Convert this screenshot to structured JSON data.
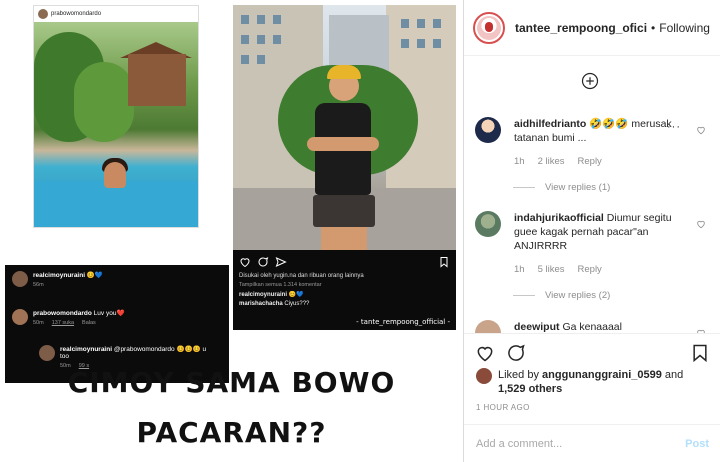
{
  "collage": {
    "pool_post": {
      "username": "prabowomondardo"
    },
    "street_post": {
      "liked_by": "Disukai oleh yugin.na dan ribuan orang lainnya",
      "view_comments": "Tampilkan semua 1.314 komentar",
      "caption_user": "realcimoynuraini",
      "caption_text": "😊💙",
      "reply_user": "marishachacha",
      "reply_text": "Ciyus???",
      "watermark": "- tante_rempoong_official -"
    },
    "chat": [
      {
        "user": "realcimoynuraini",
        "text": "😊💙",
        "time": "56m",
        "likes": "",
        "reply": ""
      },
      {
        "user": "prabowomondardo",
        "text": "Luv you❤️",
        "time": "50m",
        "likes": "137 suka",
        "reply": "Balas"
      },
      {
        "user": "realcimoynuraini",
        "text": "@prabowomondardo 😊😊😊 u too",
        "time": "50m",
        "likes": "99 s",
        "reply": ""
      }
    ],
    "headline_line1": "CIMOY SAMA BOWO",
    "headline_line2": "PACARAN??"
  },
  "panel": {
    "header": {
      "username": "tantee_rempoong_ofici",
      "separator": "•",
      "follow_status": "Following"
    },
    "add_icon": "plus-circle-icon",
    "comments": [
      {
        "user": "aidhilfedrianto",
        "text": "🤣🤣🤣 merusak tatanan bumi ...",
        "time": "1h",
        "likes": "2 likes",
        "reply": "Reply",
        "view_replies": "View replies (1)"
      },
      {
        "user": "indahjurikaofficial",
        "text": "Diumur segitu guee kagak pernah pacar\"an ANJIRRRR",
        "time": "1h",
        "likes": "5 likes",
        "reply": "Reply",
        "view_replies": "View replies (2)"
      },
      {
        "user": "deewiput",
        "text": "Ga kenaaaal",
        "time": "",
        "likes": "",
        "reply": "",
        "view_replies": ""
      }
    ],
    "likes": {
      "prefix": "Liked by",
      "user": "anggunanggraini_0599",
      "and": "and",
      "count": "1,529 others"
    },
    "time_ago": "1 HOUR AGO",
    "comment_input": {
      "placeholder": "Add a comment...",
      "value": ""
    },
    "post_label": "Post",
    "colors": {
      "link_disabled": "#b2dffc",
      "muted": "#8e8e8e",
      "text": "#262626",
      "brand_red": "#d94f4f"
    }
  }
}
